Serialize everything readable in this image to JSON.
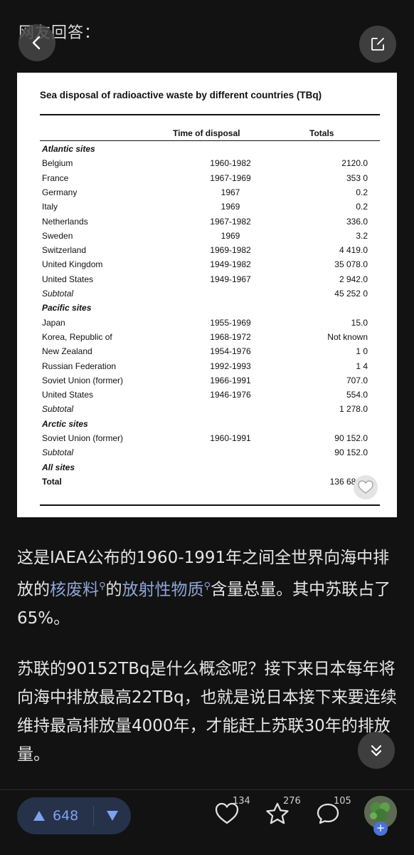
{
  "header": {
    "text": "网友回答："
  },
  "doc": {
    "title": "Sea disposal of radioactive waste by different countries (TBq)",
    "col_time": "Time of disposal",
    "col_totals": "Totals",
    "rows": [
      {
        "type": "section",
        "name": "Atlantic sites",
        "time": "",
        "total": ""
      },
      {
        "type": "data",
        "name": "Belgium",
        "time": "1960-1982",
        "total": "2120.0"
      },
      {
        "type": "data",
        "name": "France",
        "time": "1967-1969",
        "total": "353 0"
      },
      {
        "type": "data",
        "name": "Germany",
        "time": "1967",
        "total": "0.2"
      },
      {
        "type": "data",
        "name": "Italy",
        "time": "1969",
        "total": "0.2"
      },
      {
        "type": "data",
        "name": "Netherlands",
        "time": "1967-1982",
        "total": "336.0"
      },
      {
        "type": "data",
        "name": "Sweden",
        "time": "1969",
        "total": "3.2"
      },
      {
        "type": "data",
        "name": "Switzerland",
        "time": "1969-1982",
        "total": "4 419.0"
      },
      {
        "type": "data",
        "name": "United Kingdom",
        "time": "1949-1982",
        "total": "35 078.0"
      },
      {
        "type": "data",
        "name": "United States",
        "time": "1949-1967",
        "total": "2 942.0"
      },
      {
        "type": "subtotal",
        "name": "Subtotal",
        "time": "",
        "total": "45 252 0"
      },
      {
        "type": "section",
        "name": "Pacific sites",
        "time": "",
        "total": ""
      },
      {
        "type": "data",
        "name": "Japan",
        "time": "1955-1969",
        "total": "15.0"
      },
      {
        "type": "data",
        "name": "Korea, Republic of",
        "time": "1968-1972",
        "total": "Not known"
      },
      {
        "type": "data",
        "name": "New Zealand",
        "time": "1954-1976",
        "total": "1 0"
      },
      {
        "type": "data",
        "name": "Russian Federation",
        "time": "1992-1993",
        "total": "1 4"
      },
      {
        "type": "data",
        "name": "Soviet Union (former)",
        "time": "1966-1991",
        "total": "707.0"
      },
      {
        "type": "data",
        "name": "United States",
        "time": "1946-1976",
        "total": "554.0"
      },
      {
        "type": "subtotal",
        "name": "Subtotal",
        "time": "",
        "total": "1 278.0"
      },
      {
        "type": "section",
        "name": "Arctic sites",
        "time": "",
        "total": ""
      },
      {
        "type": "data",
        "name": "Soviet Union (former)",
        "time": "1960-1991",
        "total": "90 152.0"
      },
      {
        "type": "subtotal",
        "name": "Subtotal",
        "time": "",
        "total": "90 152.0"
      },
      {
        "type": "section",
        "name": "All sites",
        "time": "",
        "total": ""
      },
      {
        "type": "total",
        "name": "Total",
        "time": "",
        "total": "136 682 0"
      }
    ]
  },
  "article": {
    "p1_before": "这是IAEA公布的1960-1991年之间全世界向海中排放的",
    "p1_link1": "核废料",
    "p1_mid": "的",
    "p1_link2": "放射性物质",
    "p1_after": "含量总量。其中苏联占了65%。",
    "p2": "苏联的90152TBq是什么概念呢？接下来日本每年将向海中排放最高22TBq，也就是说日本接下来要连续维持最高排放量4000年，才能赶上苏联30年的排放量。"
  },
  "bottom": {
    "upvote_count": "648",
    "like_count": "134",
    "star_count": "276",
    "comment_count": "105",
    "avatar_plus": "+"
  },
  "colors": {
    "accent": "#7fa2f0",
    "link": "#8fa6d8",
    "background": "#121212"
  }
}
